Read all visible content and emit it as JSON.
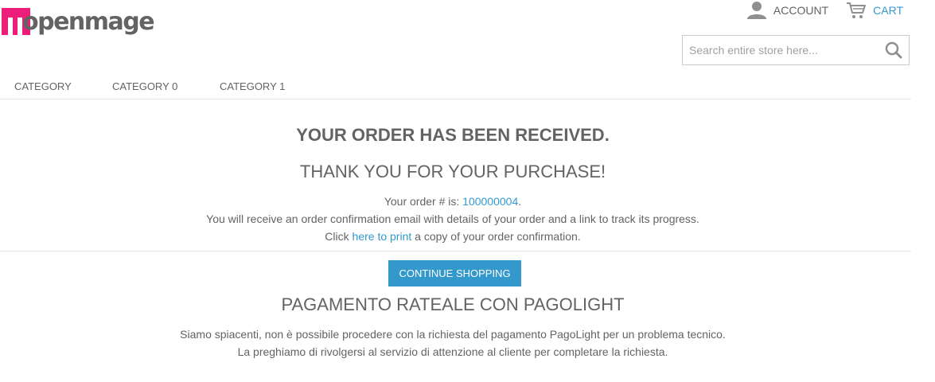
{
  "header": {
    "logo_text": "openmage",
    "account_label": "ACCOUNT",
    "cart_label": "CART",
    "search_placeholder": "Search entire store here..."
  },
  "nav": {
    "items": [
      {
        "label": "CATEGORY"
      },
      {
        "label": "CATEGORY 0"
      },
      {
        "label": "CATEGORY 1"
      }
    ]
  },
  "main": {
    "heading_received": "YOUR ORDER HAS BEEN RECEIVED.",
    "heading_thanks": "THANK YOU FOR YOUR PURCHASE!",
    "order_prefix": "Your order # is: ",
    "order_number": "100000004",
    "order_suffix": ".",
    "confirmation_text": "You will receive an order confirmation email with details of your order and a link to track its progress.",
    "print_prefix": "Click ",
    "print_link": "here to print",
    "print_suffix": " a copy of your order confirmation.",
    "continue_button": "CONTINUE SHOPPING"
  },
  "pagolight": {
    "heading": "PAGAMENTO RATEALE CON PAGOLIGHT",
    "line1": "Siamo spiacenti, non è possibile procedere con la richiesta del pagamento PagoLight per un problema tecnico.",
    "line2": "La preghiamo di rivolgersi al servizio di attenzione al cliente per completare la richiesta."
  },
  "colors": {
    "accent": "#3399cc",
    "logo_pink": "#ed1e79",
    "text": "#636363"
  },
  "icons": {
    "account": "user-icon",
    "cart": "cart-icon",
    "search": "search-icon"
  }
}
